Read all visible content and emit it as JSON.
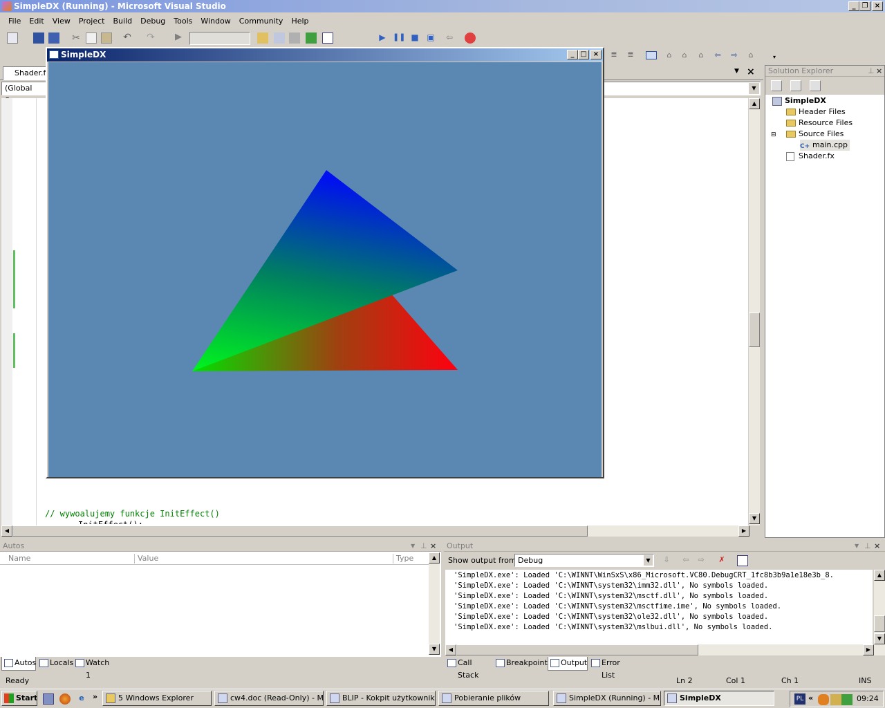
{
  "window": {
    "title": "SimpleDX (Running) - Microsoft Visual Studio",
    "minimize": "_",
    "maximize": "❐",
    "close": "×"
  },
  "menu": [
    "File",
    "Edit",
    "View",
    "Project",
    "Build",
    "Debug",
    "Tools",
    "Window",
    "Community",
    "Help"
  ],
  "editor": {
    "tab": "Shader.fx",
    "scope": "(Global Scop",
    "comment": "// wywoalujemy funkcje InitEffect()",
    "partial": "InitEffect();"
  },
  "dxwin": {
    "title": "SimpleDX",
    "bg": "#5b88b3"
  },
  "solution": {
    "title": "Solution Explorer",
    "project": "SimpleDX",
    "items": [
      "Header Files",
      "Resource Files",
      "Source Files",
      "main.cpp",
      "Shader.fx"
    ]
  },
  "autos": {
    "title": "Autos",
    "cols": [
      "Name",
      "Value",
      "Type"
    ],
    "tabs": [
      "Autos",
      "Locals",
      "Watch 1"
    ]
  },
  "output": {
    "title": "Output",
    "show_label": "Show output from:",
    "source": "Debug",
    "lines": [
      "'SimpleDX.exe': Loaded 'C:\\WINNT\\WinSxS\\x86_Microsoft.VC80.DebugCRT_1fc8b3b9a1e18e3b_8.",
      "'SimpleDX.exe': Loaded 'C:\\WINNT\\system32\\imm32.dll', No symbols loaded.",
      "'SimpleDX.exe': Loaded 'C:\\WINNT\\system32\\msctf.dll', No symbols loaded.",
      "'SimpleDX.exe': Loaded 'C:\\WINNT\\system32\\msctfime.ime', No symbols loaded.",
      "'SimpleDX.exe': Loaded 'C:\\WINNT\\system32\\ole32.dll', No symbols loaded.",
      "'SimpleDX.exe': Loaded 'C:\\WINNT\\system32\\mslbui.dll', No symbols loaded."
    ],
    "tabs": [
      "Call Stack",
      "Breakpoints",
      "Output",
      "Error List"
    ]
  },
  "status": {
    "text": "Ready",
    "ln": "Ln 2",
    "col": "Col 1",
    "ch": "Ch 1",
    "ins": "INS"
  },
  "taskbar": {
    "start": "Start",
    "more": "»",
    "buttons": [
      "5 Windows Explorer",
      "cw4.doc (Read-Only) - M...",
      "BLIP - Kokpit użytkownik...",
      "Pobieranie plików",
      "SimpleDX (Running) - Mic...",
      "SimpleDX"
    ],
    "lang": "PL",
    "tray_more": "«",
    "clock": "09:24"
  }
}
